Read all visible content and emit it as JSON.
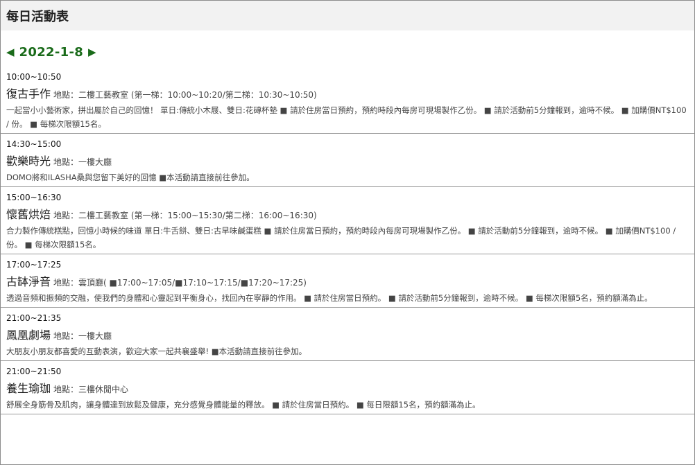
{
  "header": {
    "title": "每日活動表"
  },
  "date_nav": {
    "prev_icon": "◀",
    "date": "2022-1-8",
    "next_icon": "▶"
  },
  "location_label": "地點：",
  "events": [
    {
      "time": "10:00~10:50",
      "title": "復古手作",
      "location": "二樓工藝教室 (第一梯：10:00~10:20/第二梯：10:30~10:50)",
      "description": "一起當小小藝術家，拼出屬於自己的回憶！ 單日:傳統小木屐、雙日:花磚杯墊 ■ 請於住房當日預約，預約時段內每房可現場製作乙份。 ■ 請於活動前5分鐘報到，逾時不候。 ■ 加購價NT$100 / 份。 ■ 每梯次限額15名。"
    },
    {
      "time": "14:30~15:00",
      "title": "歡樂時光",
      "location": "一樓大廳",
      "description": "DOMO將和ILASHA桑與您留下美好的回憶 ■本活動請直接前往參加。"
    },
    {
      "time": "15:00~16:30",
      "title": "懷舊烘焙",
      "location": "二樓工藝教室 (第一梯：15:00~15:30/第二梯：16:00~16:30)",
      "description": "合力製作傳統糕點，回憶小時候的味道 單日:牛舌餅、雙日:古早味鹹蛋糕 ■ 請於住房當日預約，預約時段內每房可現場製作乙份。 ■ 請於活動前5分鐘報到，逾時不候。 ■ 加購價NT$100 / 份。 ■ 每梯次限額15名。"
    },
    {
      "time": "17:00~17:25",
      "title": "古缽淨音",
      "location": "雲頂廳( ■17:00~17:05/■17:10~17:15/■17:20~17:25)",
      "description": "透過音頻和振頻的交融，使我們的身體和心靈起到平衡身心，找回內在寧靜的作用。 ■ 請於住房當日預約。 ■ 請於活動前5分鐘報到，逾時不候。 ■ 每梯次限額5名，預約額滿為止。"
    },
    {
      "time": "21:00~21:35",
      "title": "鳳凰劇場",
      "location": "一樓大廳",
      "description": "大朋友小朋友都喜愛的互動表演，歡迎大家一起共襄盛舉! ■本活動請直接前往參加。"
    },
    {
      "time": "21:00~21:50",
      "title": "養生瑜珈",
      "location": "三樓休閒中心",
      "description": "舒展全身筋骨及肌肉，讓身體達到放鬆及健康，充分感覺身體能量的釋放。 ■ 請於住房當日預約。 ■ 每日限額15名，預約額滿為止。"
    }
  ]
}
